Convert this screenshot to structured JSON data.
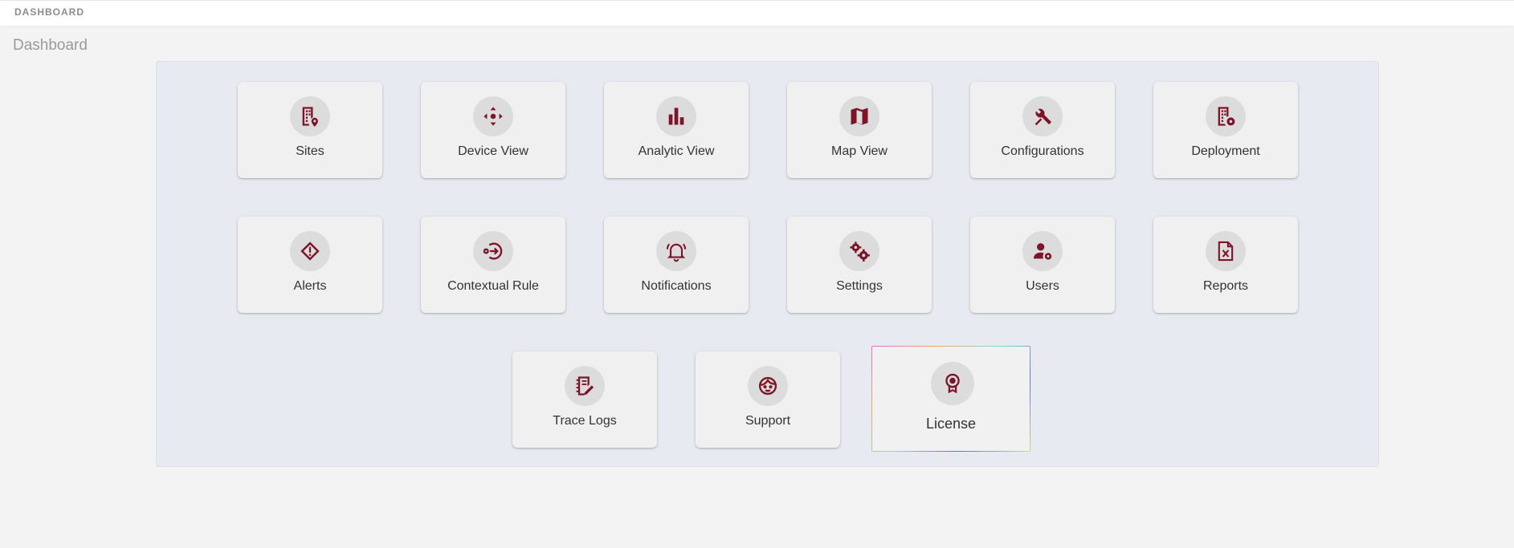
{
  "header": {
    "breadcrumb": "DASHBOARD"
  },
  "page": {
    "title": "Dashboard"
  },
  "theme": {
    "icon_color": "#7d1428",
    "panel_bg": "#e8eaf2",
    "tile_bg": "#f0f0f0"
  },
  "tiles": [
    {
      "label": "Sites",
      "icon": "building-pin-icon"
    },
    {
      "label": "Device View",
      "icon": "move-arrows-icon"
    },
    {
      "label": "Analytic View",
      "icon": "bar-chart-icon"
    },
    {
      "label": "Map View",
      "icon": "map-icon"
    },
    {
      "label": "Configurations",
      "icon": "tools-icon"
    },
    {
      "label": "Deployment",
      "icon": "building-gear-icon"
    },
    {
      "label": "Alerts",
      "icon": "alert-diamond-icon"
    },
    {
      "label": "Contextual Rule",
      "icon": "rule-circle-arrow-icon"
    },
    {
      "label": "Notifications",
      "icon": "bell-ringing-icon"
    },
    {
      "label": "Settings",
      "icon": "gears-icon"
    },
    {
      "label": "Users",
      "icon": "user-gear-icon"
    },
    {
      "label": "Reports",
      "icon": "excel-file-icon"
    },
    {
      "label": "Trace Logs",
      "icon": "notebook-edit-icon"
    },
    {
      "label": "Support",
      "icon": "support-face-icon"
    },
    {
      "label": "License",
      "icon": "award-badge-icon"
    }
  ]
}
